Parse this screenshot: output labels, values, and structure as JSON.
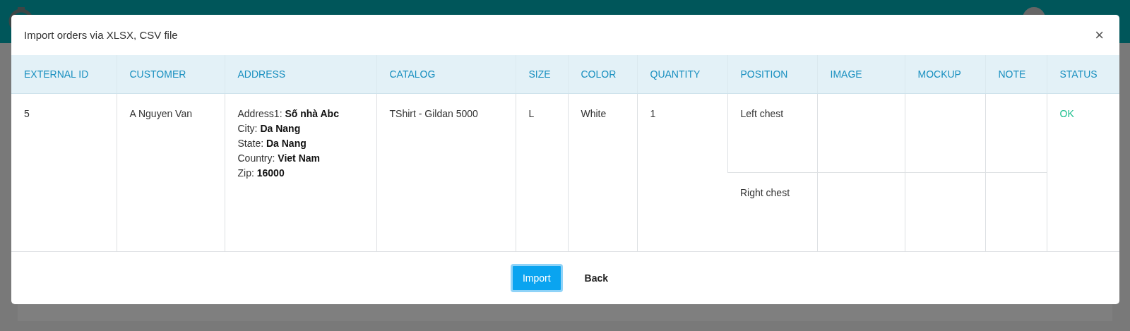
{
  "dialog": {
    "title": "Import orders via XLSX, CSV file",
    "close": "×"
  },
  "table": {
    "columns": [
      "EXTERNAL ID",
      "CUSTOMER",
      "ADDRESS",
      "CATALOG",
      "SIZE",
      "COLOR",
      "QUANTITY",
      "POSITION",
      "IMAGE",
      "MOCKUP",
      "NOTE",
      "STATUS"
    ],
    "rows": [
      {
        "external_id": "5",
        "customer": "A Nguyen Van",
        "address": [
          "Address1: **Số nhà Abc**",
          "City: **Da Nang**",
          "State: **Da Nang**",
          "Country: **Viet Nam**",
          "Zip: **16000**"
        ],
        "catalog": "TShirt - Gildan 5000",
        "size": "L",
        "shirt_color": "White",
        "quantity": "1",
        "positions": [
          "Left chest",
          "Right chest"
        ],
        "status": {
          "text": "OK",
          "kind": "ok"
        }
      }
    ]
  },
  "buttons": [
    {
      "label": "Import",
      "kind": "primary"
    },
    {
      "label": "Back",
      "kind": "plain"
    }
  ]
}
